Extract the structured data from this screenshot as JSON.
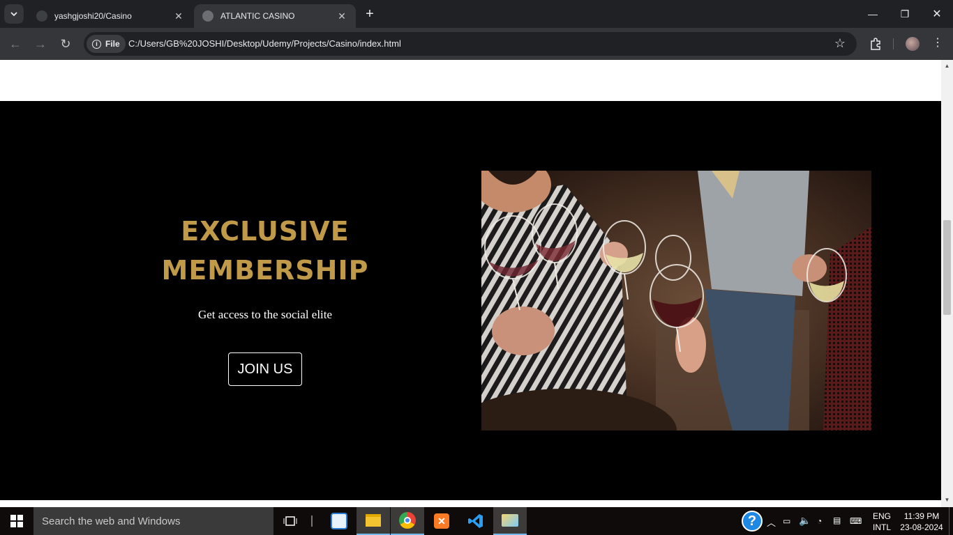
{
  "browser": {
    "tabs": [
      {
        "title": "yashgjoshi20/Casino",
        "active": false
      },
      {
        "title": "ATLANTIC CASINO",
        "active": true
      }
    ],
    "file_chip": "File",
    "url": "C:/Users/GB%20JOSHI/Desktop/Udemy/Projects/Casino/index.html",
    "icons": {
      "tab_search": "chevron-down-icon",
      "new_tab": "plus-icon",
      "back": "arrow-left-icon",
      "forward": "arrow-right-icon",
      "reload": "reload-icon",
      "bookmark": "star-icon",
      "extensions": "puzzle-icon"
    }
  },
  "page": {
    "heading_line1": "EXCLUSIVE",
    "heading_line2": "MEMBERSHIP",
    "subtitle": "Get access to the social elite",
    "cta": "JOIN US",
    "accent_color": "#c09a48"
  },
  "taskbar": {
    "search_placeholder": "Search the web and Windows",
    "lang_line1": "ENG",
    "lang_line2": "INTL",
    "time": "11:39 PM",
    "date": "23-08-2024"
  }
}
